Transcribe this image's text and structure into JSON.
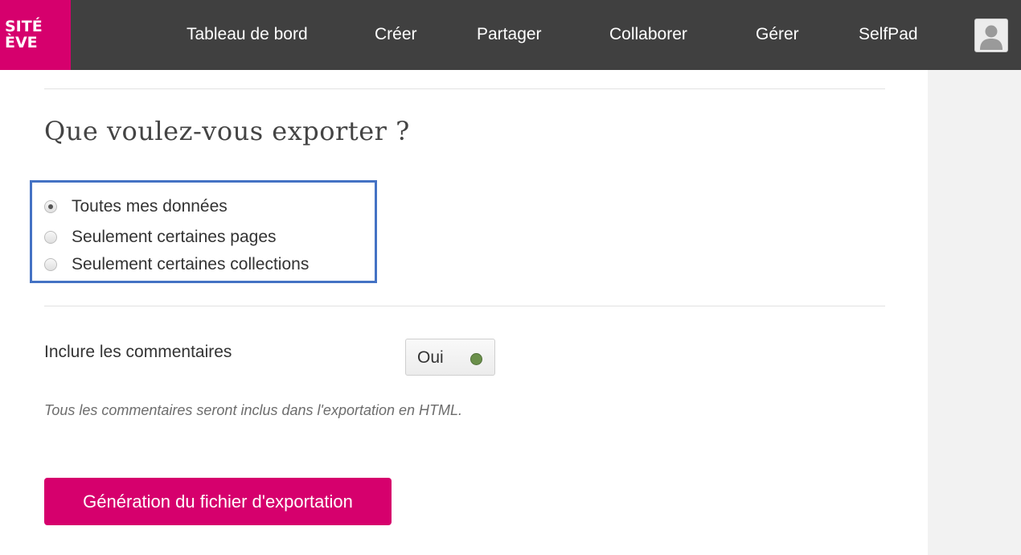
{
  "brand": {
    "line1": "SITÉ",
    "line2": "ÈVE",
    "color": "#d6006d"
  },
  "nav": {
    "items": [
      {
        "label": "Tableau de bord"
      },
      {
        "label": "Créer"
      },
      {
        "label": "Partager"
      },
      {
        "label": "Collaborer"
      },
      {
        "label": "Gérer"
      },
      {
        "label": "SelfPad"
      }
    ],
    "avatar_icon": "user-avatar-icon"
  },
  "page": {
    "heading": "Que voulez-vous exporter ?",
    "export_options": [
      {
        "label": "Toutes mes données",
        "checked": true
      },
      {
        "label": "Seulement certaines pages",
        "checked": false
      },
      {
        "label": "Seulement certaines collections",
        "checked": false
      }
    ],
    "comments": {
      "label": "Inclure les commentaires",
      "toggle_value": "Oui",
      "toggle_color": "#6a8f4a",
      "hint": "Tous les commentaires seront inclus dans l'exportation en HTML."
    },
    "submit_label": "Génération du fichier d'exportation"
  },
  "colors": {
    "topbar": "#404040",
    "accent": "#d6006d",
    "highlight_border": "#4472c4"
  }
}
